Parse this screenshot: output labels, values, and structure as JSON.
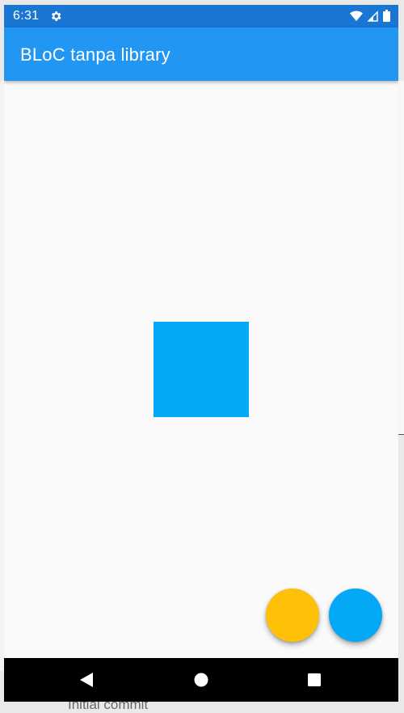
{
  "status_bar": {
    "time": "6:31",
    "icons": [
      "settings-gear-icon",
      "wifi-icon",
      "cell-signal-icon",
      "battery-icon"
    ],
    "color": "#1976d2"
  },
  "app_bar": {
    "title": "BLoC tanpa library",
    "color": "#2196f3"
  },
  "content": {
    "box_color": "#03a9f4"
  },
  "fabs": [
    {
      "name": "amber-fab",
      "color": "#ffc107"
    },
    {
      "name": "light-blue-fab",
      "color": "#03a9f4"
    }
  ],
  "nav_bar": {
    "buttons": [
      "back-icon",
      "home-icon",
      "recents-icon"
    ]
  },
  "background": {
    "commit_text": "Initial commit"
  }
}
